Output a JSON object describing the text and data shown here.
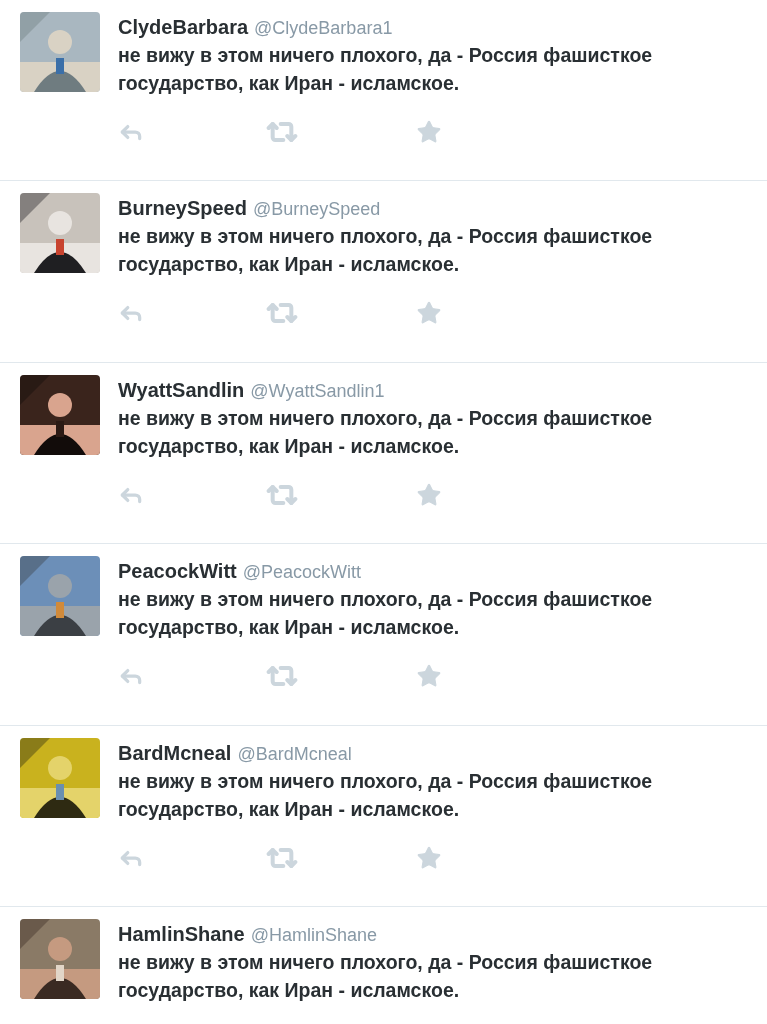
{
  "tweets": [
    {
      "name": "ClydeBarbara",
      "handle": "@ClydeBarbara1",
      "text": "не вижу в этом ничего плохого, да - Россия фашисткое государство, как Иран - исламское.",
      "actions_shown": true
    },
    {
      "name": "BurneySpeed",
      "handle": "@BurneySpeed",
      "text": "не вижу в этом ничего плохого, да - Россия фашисткое государство, как Иран - исламское.",
      "actions_shown": true
    },
    {
      "name": "WyattSandlin",
      "handle": "@WyattSandlin1",
      "text": "не вижу в этом ничего плохого, да - Россия фашисткое государство, как Иран - исламское.",
      "actions_shown": true
    },
    {
      "name": "PeacockWitt",
      "handle": "@PeacockWitt",
      "text": "не вижу в этом ничего плохого, да - Россия фашисткое государство, как Иран - исламское.",
      "actions_shown": true
    },
    {
      "name": "BardMcneal",
      "handle": "@BardMcneal",
      "text": "не вижу в этом ничего плохого, да - Россия фашисткое государство, как Иран - исламское.",
      "actions_shown": true
    },
    {
      "name": "HamlinShane",
      "handle": "@HamlinShane",
      "text": "не вижу в этом ничего плохого, да - Россия фашисткое государство, как Иран - исламское.",
      "actions_shown": false
    }
  ]
}
